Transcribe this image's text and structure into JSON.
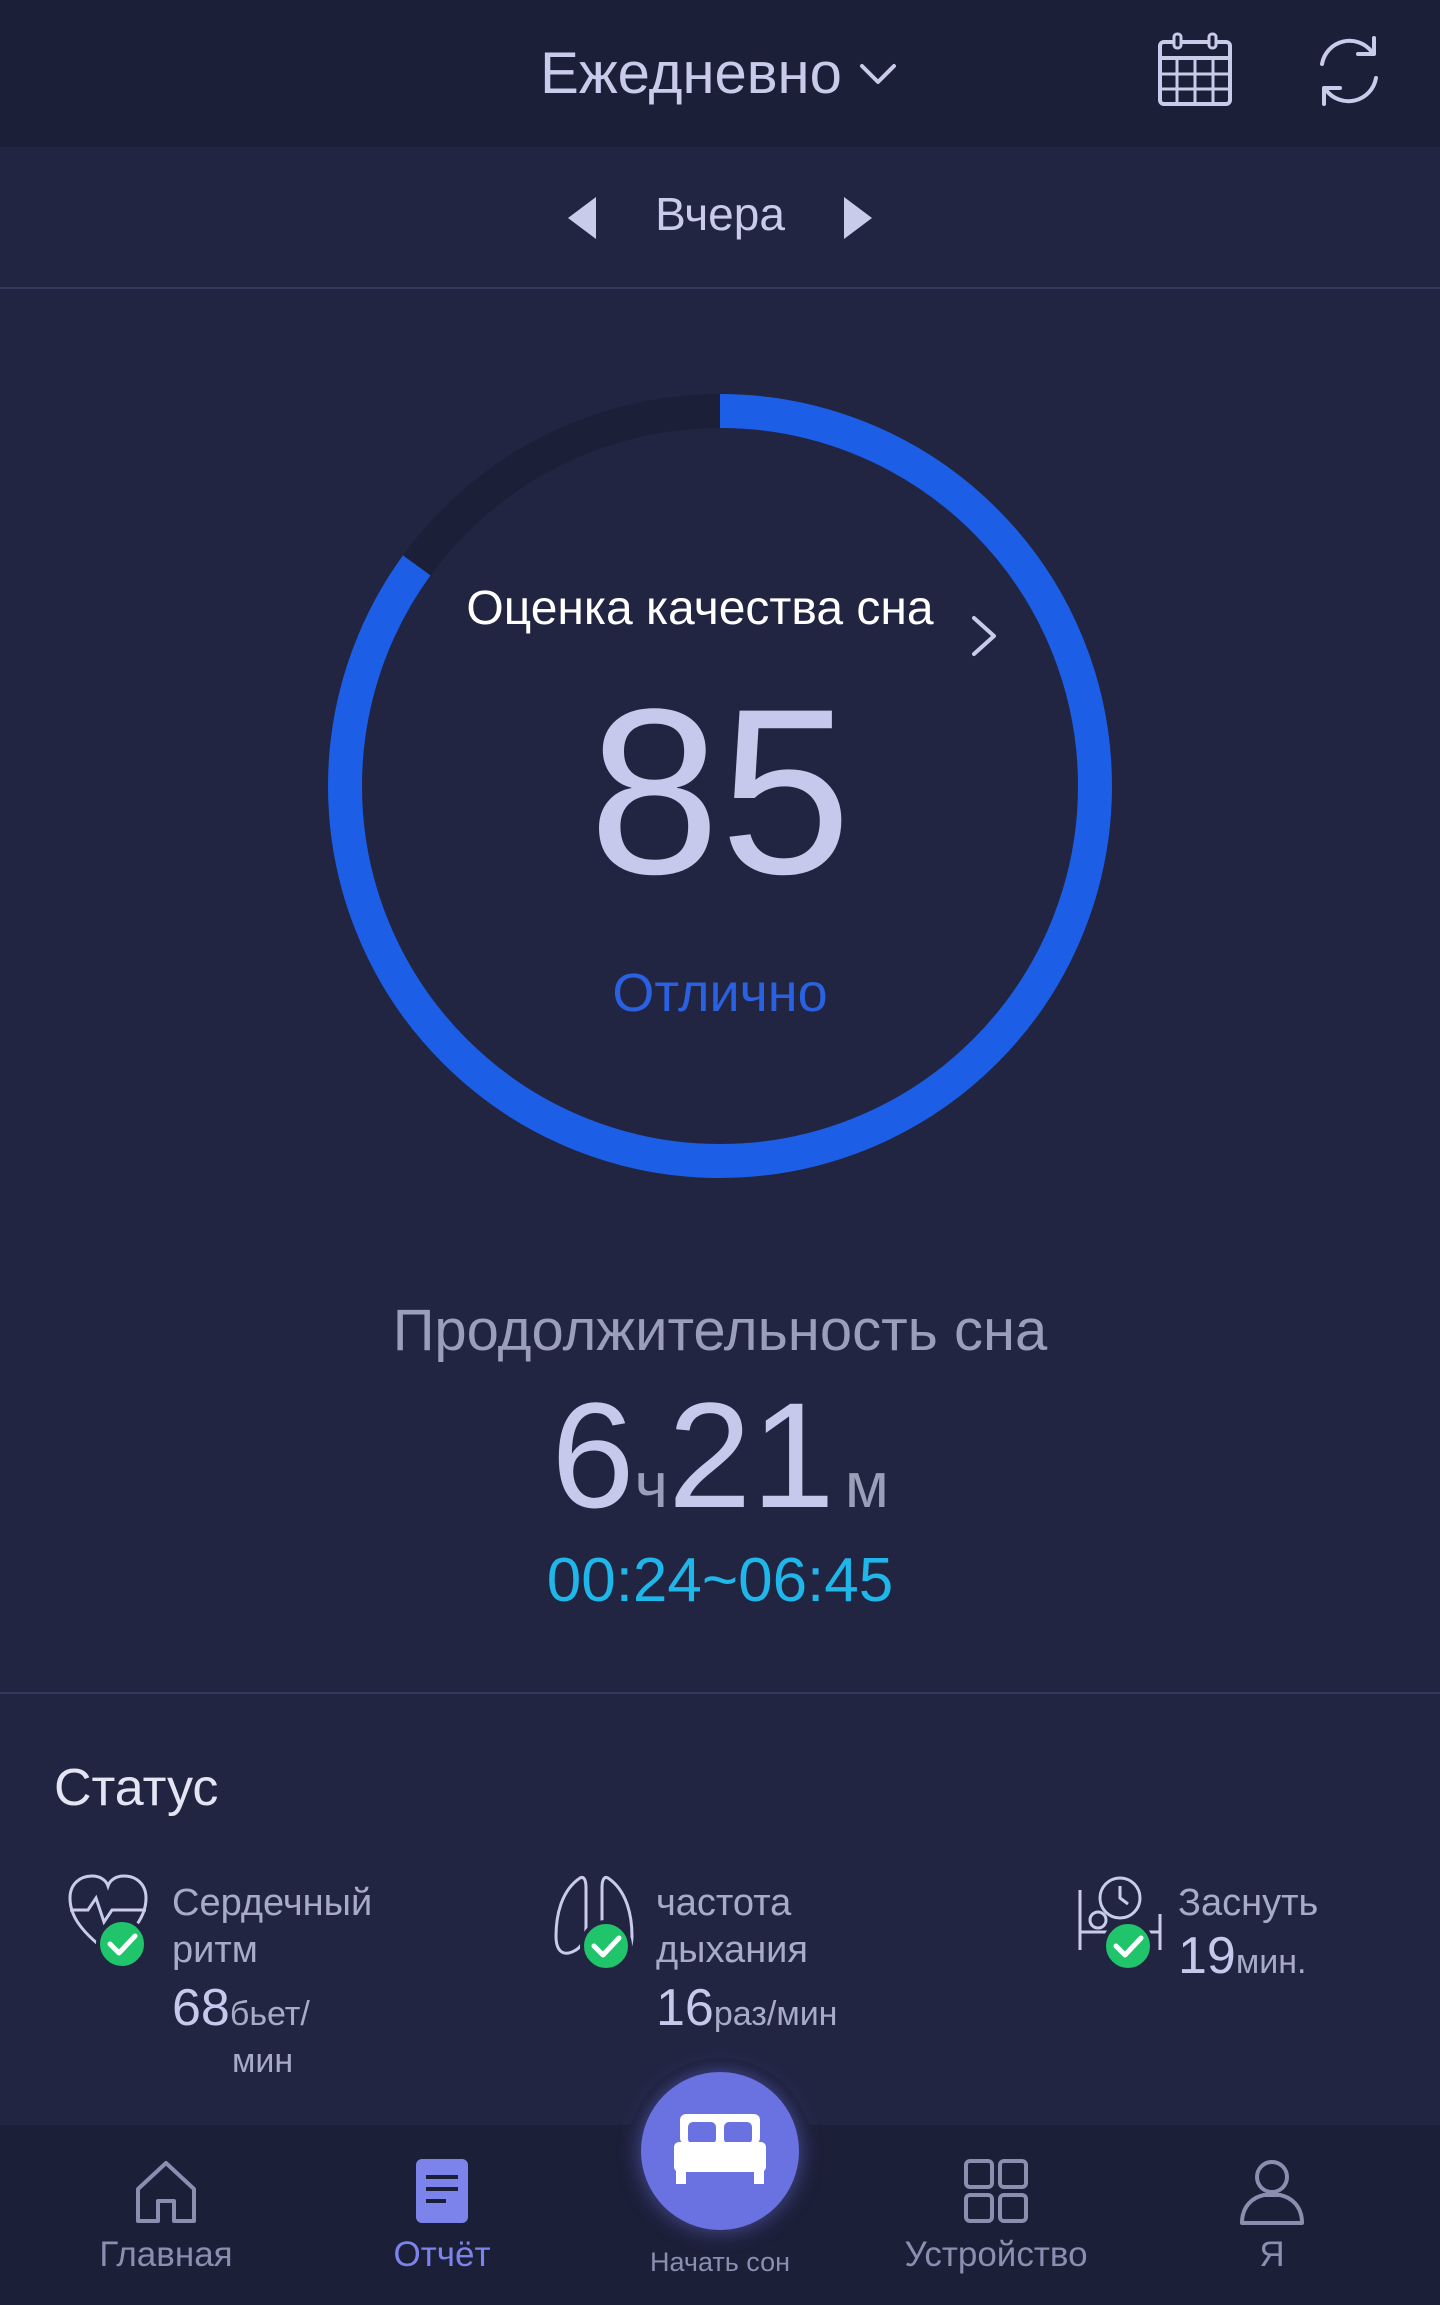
{
  "header": {
    "title": "Ежедневно",
    "icons": [
      "chevron-down-icon",
      "calendar-icon",
      "refresh-icon"
    ]
  },
  "day_nav": {
    "label": "Вчера",
    "icons": [
      "prev-arrow-icon",
      "next-arrow-icon"
    ]
  },
  "score": {
    "title": "Оценка качества сна",
    "value": "85",
    "grade": "Отлично",
    "fraction": 0.85,
    "ring_color": "#1c5fe6",
    "track_color": "#1c1f38"
  },
  "duration": {
    "label": "Продолжительность сна",
    "hours": "6",
    "hours_unit": "ч",
    "minutes": "21",
    "minutes_unit": "м",
    "range": "00:24~06:45"
  },
  "status": {
    "title": "Статус",
    "items": [
      {
        "icon": "heart-check-icon",
        "label_line1": "Сердечный",
        "label_line2": "ритм",
        "value": "68",
        "unit_line1": "бьет/",
        "unit_line2": "мин"
      },
      {
        "icon": "lungs-check-icon",
        "label_line1": "частота",
        "label_line2": "дыхания",
        "value": "16",
        "unit": "раз/мин"
      },
      {
        "icon": "sleep-onset-check-icon",
        "label_line1": "Заснуть",
        "value": "19",
        "unit": "мин."
      }
    ]
  },
  "bottom_nav": {
    "items": [
      {
        "label": "Главная",
        "icon": "home-icon"
      },
      {
        "label": "Отчёт",
        "icon": "report-icon",
        "active": true
      },
      {
        "label": "Начать сон",
        "icon": "bed-icon"
      },
      {
        "label": "Устройство",
        "icon": "device-grid-icon"
      },
      {
        "label": "Я",
        "icon": "profile-icon"
      }
    ]
  },
  "colors": {
    "background": "#222542",
    "accent_blue": "#1c5fe6",
    "range_cyan": "#1fb6ea",
    "check_green": "#1fc46b",
    "active_nav": "#7c84ec"
  }
}
